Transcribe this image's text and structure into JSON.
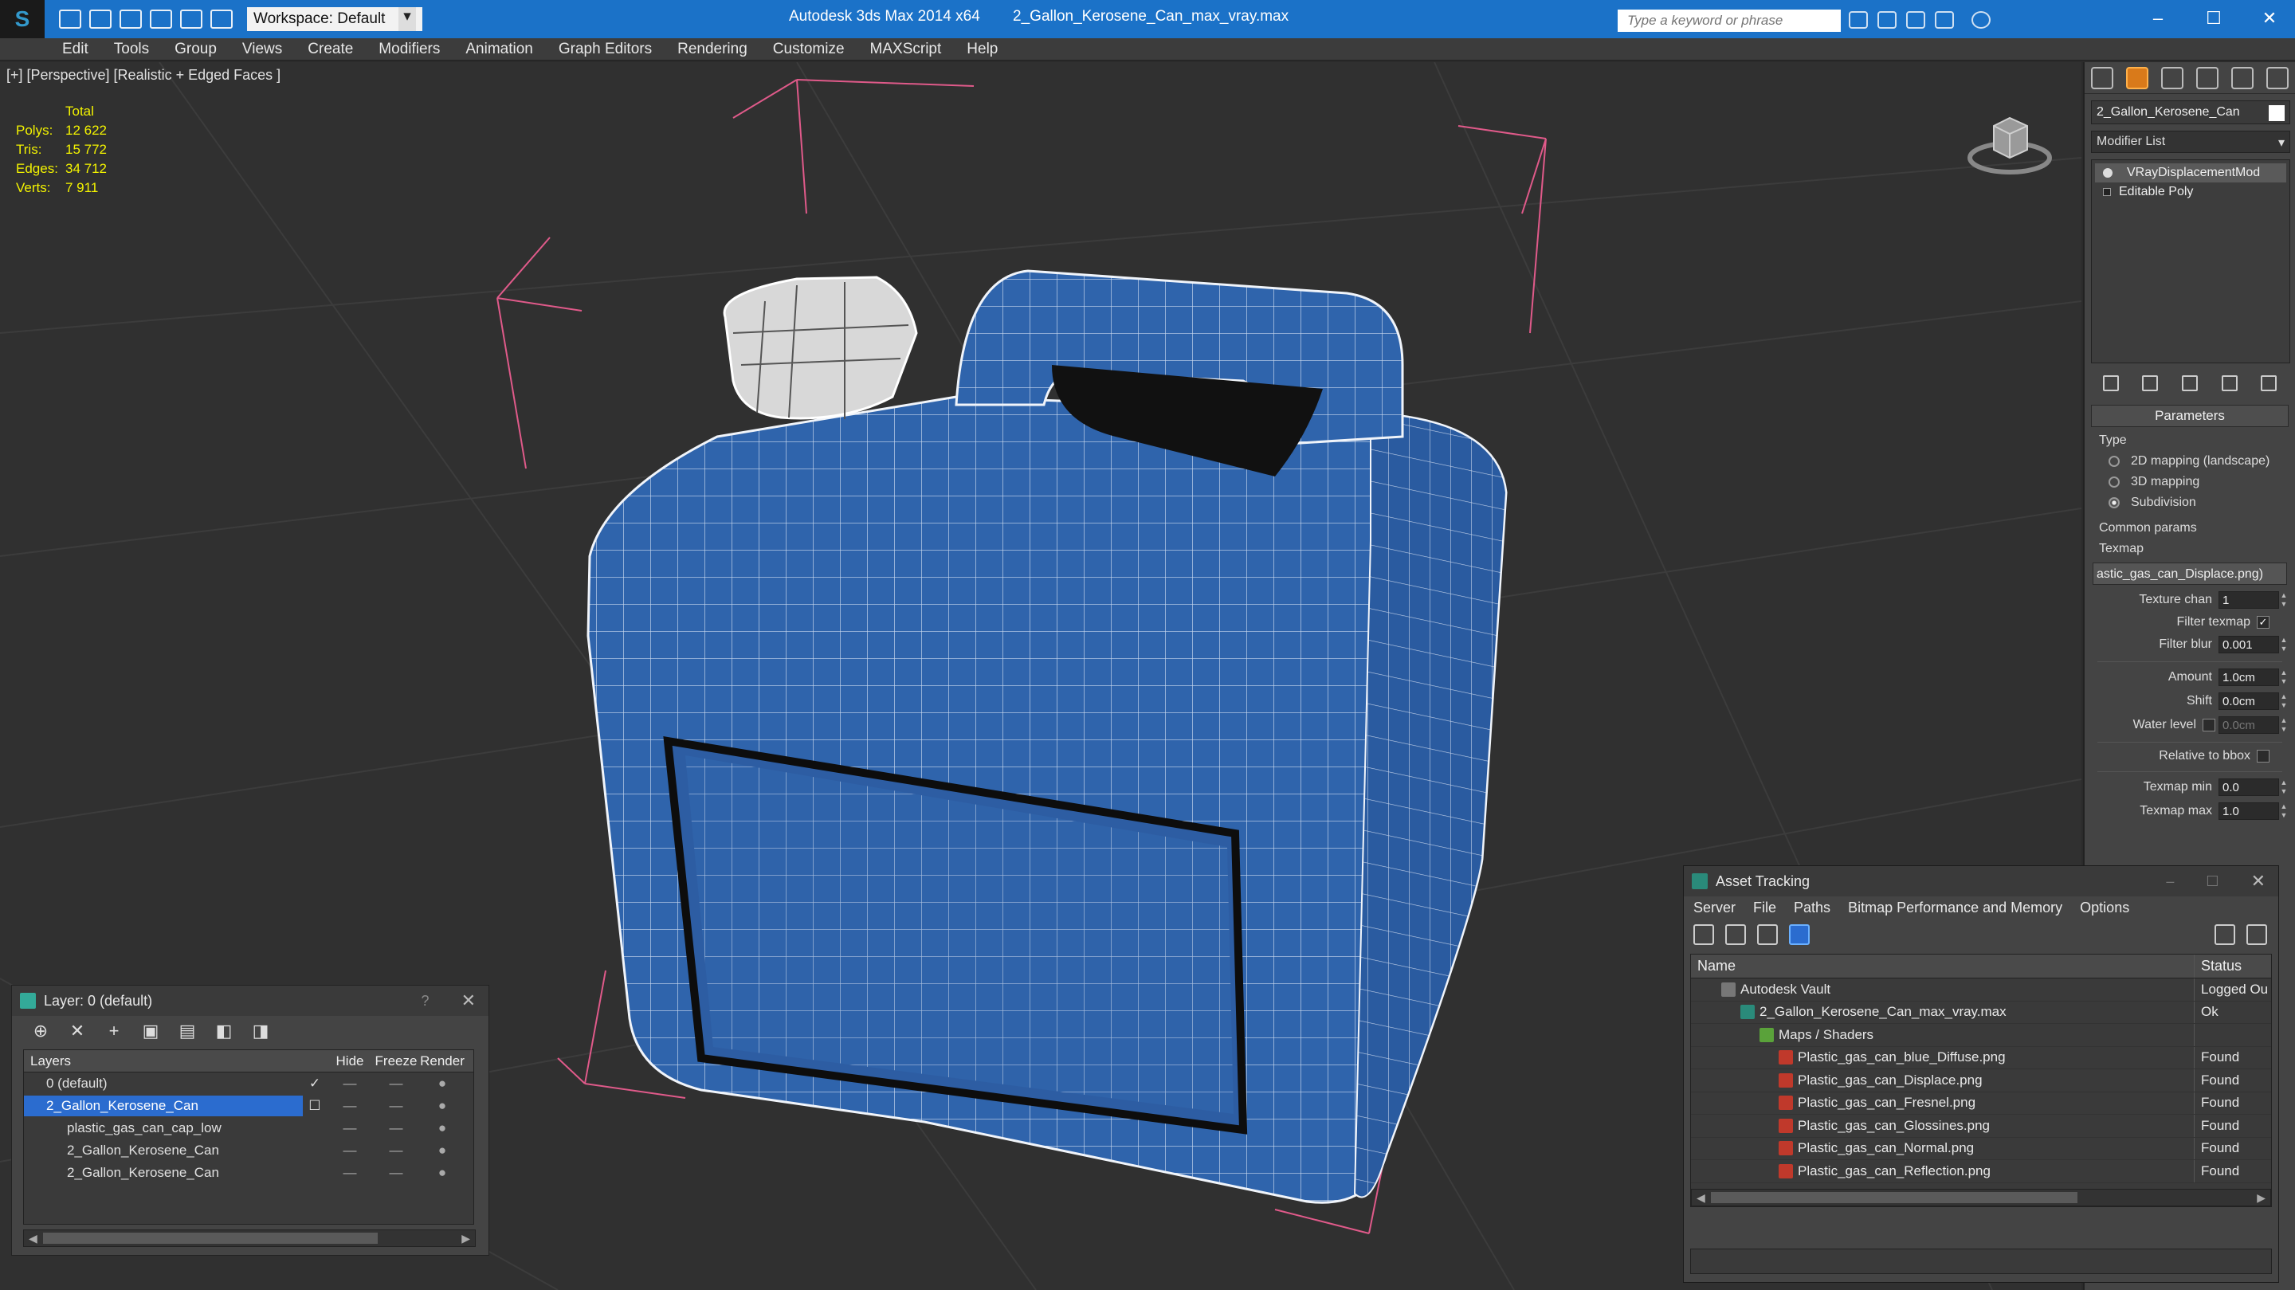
{
  "titlebar": {
    "workspace_label": "Workspace: Default",
    "app_name": "Autodesk 3ds Max  2014 x64",
    "file_name": "2_Gallon_Kerosene_Can_max_vray.max",
    "search_placeholder": "Type a keyword or phrase",
    "accent_color": "#1b72c8"
  },
  "menubar": {
    "items": [
      "Edit",
      "Tools",
      "Group",
      "Views",
      "Create",
      "Modifiers",
      "Animation",
      "Graph Editors",
      "Rendering",
      "Customize",
      "MAXScript",
      "Help"
    ]
  },
  "viewport": {
    "label": "[+] [Perspective] [Realistic + Edged Faces ]",
    "stats": {
      "header": "Total",
      "rows": [
        {
          "label": "Polys:",
          "value": "12 622"
        },
        {
          "label": "Tris:",
          "value": "15 772"
        },
        {
          "label": "Edges:",
          "value": "34 712"
        },
        {
          "label": "Verts:",
          "value": "7 911"
        }
      ]
    }
  },
  "command_panel": {
    "object_name": "2_Gallon_Kerosene_Can",
    "modifier_list": "Modifier List",
    "stack": [
      "VRayDisplacementMod",
      "Editable Poly"
    ],
    "parameters_title": "Parameters",
    "type_label": "Type",
    "type_options": [
      "2D mapping (landscape)",
      "3D mapping",
      "Subdivision"
    ],
    "type_selected": "Subdivision",
    "common_params_label": "Common params",
    "texmap_label": "Texmap",
    "texmap_value": "astic_gas_can_Displace.png)",
    "texture_chan_label": "Texture chan",
    "texture_chan_value": "1",
    "filter_texmap_label": "Filter texmap",
    "filter_blur_label": "Filter blur",
    "filter_blur_value": "0.001",
    "amount_label": "Amount",
    "amount_value": "1.0cm",
    "shift_label": "Shift",
    "shift_value": "0.0cm",
    "water_level_label": "Water level",
    "water_level_value": "0.0cm",
    "relative_bbox_label": "Relative to bbox",
    "texmap_min_label": "Texmap min",
    "texmap_min_value": "0.0",
    "texmap_max_label": "Texmap max",
    "texmap_max_value": "1.0"
  },
  "layer_panel": {
    "title": "Layer: 0 (default)",
    "help": "?",
    "columns": [
      "Layers",
      "Hide",
      "Freeze",
      "Render"
    ],
    "rows": [
      {
        "name": "0 (default)"
      },
      {
        "name": "2_Gallon_Kerosene_Can"
      },
      {
        "name": "plastic_gas_can_cap_low"
      },
      {
        "name": "2_Gallon_Kerosene_Can"
      },
      {
        "name": "2_Gallon_Kerosene_Can"
      }
    ]
  },
  "asset_tracking": {
    "title": "Asset Tracking",
    "menu": [
      "Server",
      "File",
      "Paths",
      "Bitmap Performance and Memory",
      "Options"
    ],
    "columns": [
      "Name",
      "Status"
    ],
    "rows": [
      {
        "name": "Autodesk Vault",
        "status": "Logged Ou"
      },
      {
        "name": "2_Gallon_Kerosene_Can_max_vray.max",
        "status": "Ok"
      },
      {
        "name": "Maps / Shaders",
        "status": ""
      },
      {
        "name": "Plastic_gas_can_blue_Diffuse.png",
        "status": "Found"
      },
      {
        "name": "Plastic_gas_can_Displace.png",
        "status": "Found"
      },
      {
        "name": "Plastic_gas_can_Fresnel.png",
        "status": "Found"
      },
      {
        "name": "Plastic_gas_can_Glossines.png",
        "status": "Found"
      },
      {
        "name": "Plastic_gas_can_Normal.png",
        "status": "Found"
      },
      {
        "name": "Plastic_gas_can_Reflection.png",
        "status": "Found"
      }
    ]
  }
}
